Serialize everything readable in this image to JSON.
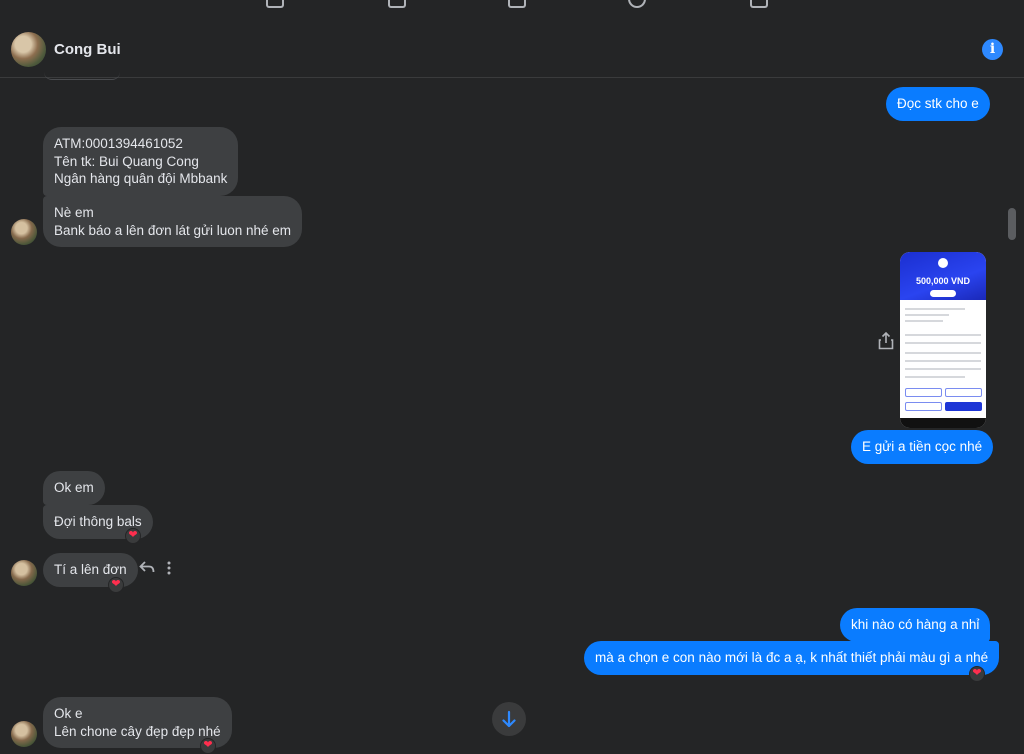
{
  "header": {
    "contact_name": "Cong Bui",
    "info_icon": "info-icon",
    "info_glyph": "i"
  },
  "nav_icons": [
    "nav-icon-1",
    "nav-icon-2",
    "nav-icon-3",
    "nav-icon-4",
    "nav-icon-5"
  ],
  "messages": [
    {
      "from": "me",
      "lines": [
        "Đọc stk cho e"
      ]
    },
    {
      "from": "them",
      "lines": [
        "ATM:0001394461052",
        "Tên tk: Bui Quang Cong",
        "Ngân hàng quân đội Mbbank"
      ]
    },
    {
      "from": "them",
      "lines": [
        "Nè em",
        "Bank báo a lên đơn lát gửi luon nhé em"
      ]
    },
    {
      "from": "me",
      "type": "image",
      "image": {
        "amount": "500,000 VND"
      }
    },
    {
      "from": "me",
      "lines": [
        "E gửi a tiền cọc nhé"
      ]
    },
    {
      "from": "them",
      "lines": [
        "Ok em"
      ]
    },
    {
      "from": "them",
      "lines": [
        "Đợi thông bals"
      ],
      "reaction": "❤"
    },
    {
      "from": "them",
      "lines": [
        "Tí a lên đơn"
      ],
      "reaction": "❤"
    },
    {
      "from": "me",
      "lines": [
        "khi nào có hàng a nhỉ"
      ]
    },
    {
      "from": "me",
      "lines": [
        "mà a chọn e con nào mới là đc a ạ, k nhất thiết phải màu gì a nhé"
      ],
      "reaction": "❤"
    },
    {
      "from": "them",
      "lines": [
        "Ok e",
        "Lên chone cây đẹp đẹp nhé"
      ],
      "reaction": "❤"
    }
  ],
  "colors": {
    "background": "#242526",
    "incoming_bubble": "#3e4042",
    "outgoing_bubble": "#0a7cff",
    "accent": "#2e89ff",
    "heart": "#ff2e4e"
  }
}
